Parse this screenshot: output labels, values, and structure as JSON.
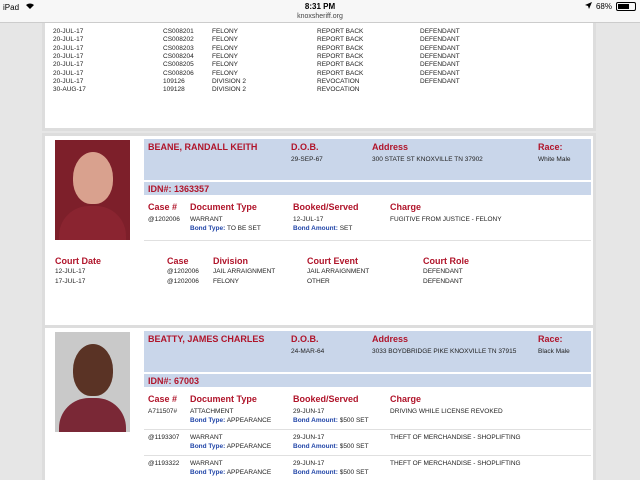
{
  "status": {
    "device": "iPad",
    "wifi_icon": "wifi-icon",
    "time": "8:31 PM",
    "battery": "68%",
    "battery_level": 0.68
  },
  "url": "knoxsheriff.org",
  "prior_cases": [
    [
      "20-JUL-17",
      "CS008201",
      "FELONY",
      "REPORT BACK",
      "DEFENDANT"
    ],
    [
      "20-JUL-17",
      "CS008202",
      "FELONY",
      "REPORT BACK",
      "DEFENDANT"
    ],
    [
      "20-JUL-17",
      "CS008203",
      "FELONY",
      "REPORT BACK",
      "DEFENDANT"
    ],
    [
      "20-JUL-17",
      "CS008204",
      "FELONY",
      "REPORT BACK",
      "DEFENDANT"
    ],
    [
      "20-JUL-17",
      "CS008205",
      "FELONY",
      "REPORT BACK",
      "DEFENDANT"
    ],
    [
      "20-JUL-17",
      "CS008206",
      "FELONY",
      "REPORT BACK",
      "DEFENDANT"
    ],
    [
      "20-JUL-17",
      "109126",
      "DIVISION 2",
      "REVOCATION",
      "DEFENDANT"
    ],
    [
      "30-AUG-17",
      "109128",
      "DIVISION 2",
      "REVOCATION",
      ""
    ]
  ],
  "labels": {
    "dob": "D.O.B.",
    "address": "Address",
    "race": "Race:",
    "idn": "IDN#:",
    "case_no": "Case #",
    "doc_type": "Document Type",
    "booked": "Booked/Served",
    "charge": "Charge",
    "bond_type": "Bond Type:",
    "bond_amount": "Bond Amount:",
    "court_date": "Court Date",
    "case": "Case",
    "division": "Division",
    "court_event": "Court Event",
    "court_role": "Court Role"
  },
  "inmate1": {
    "name": "BEANE, RANDALL KEITH",
    "dob": "29-SEP-67",
    "address": "300 STATE ST KNOXVILLE TN 37902",
    "race": "White Male",
    "idn": "1363357",
    "charges": [
      {
        "case": "@1202006",
        "doc": "WARRANT",
        "bond_type": "TO BE SET",
        "booked": "12-JUL-17",
        "bond_amount": "SET",
        "charge": "FUGITIVE FROM JUSTICE - FELONY"
      }
    ],
    "court": [
      [
        "12-JUL-17",
        "@1202006",
        "JAIL ARRAIGNMENT",
        "JAIL ARRAIGNMENT",
        "DEFENDANT"
      ],
      [
        "17-JUL-17",
        "@1202006",
        "FELONY",
        "OTHER",
        "DEFENDANT"
      ]
    ]
  },
  "inmate2": {
    "name": "BEATTY, JAMES CHARLES",
    "dob": "24-MAR-64",
    "address": "3033 BOYDBRIDGE PIKE KNOXVILLE TN 37915",
    "race": "Black Male",
    "idn": "67003",
    "charges": [
      {
        "case": "A711507#",
        "doc": "ATTACHMENT",
        "bond_type": "APPEARANCE",
        "booked": "29-JUN-17",
        "bond_amount": "$500 SET",
        "charge": "DRIVING WHILE LICENSE REVOKED"
      },
      {
        "case": "@1193307",
        "doc": "WARRANT",
        "bond_type": "APPEARANCE",
        "booked": "29-JUN-17",
        "bond_amount": "$500 SET",
        "charge": "THEFT OF MERCHANDISE - SHOPLIFTING"
      },
      {
        "case": "@1193322",
        "doc": "WARRANT",
        "bond_type": "APPEARANCE",
        "booked": "29-JUN-17",
        "bond_amount": "$500 SET",
        "charge": "THEFT OF MERCHANDISE - SHOPLIFTING"
      }
    ]
  }
}
